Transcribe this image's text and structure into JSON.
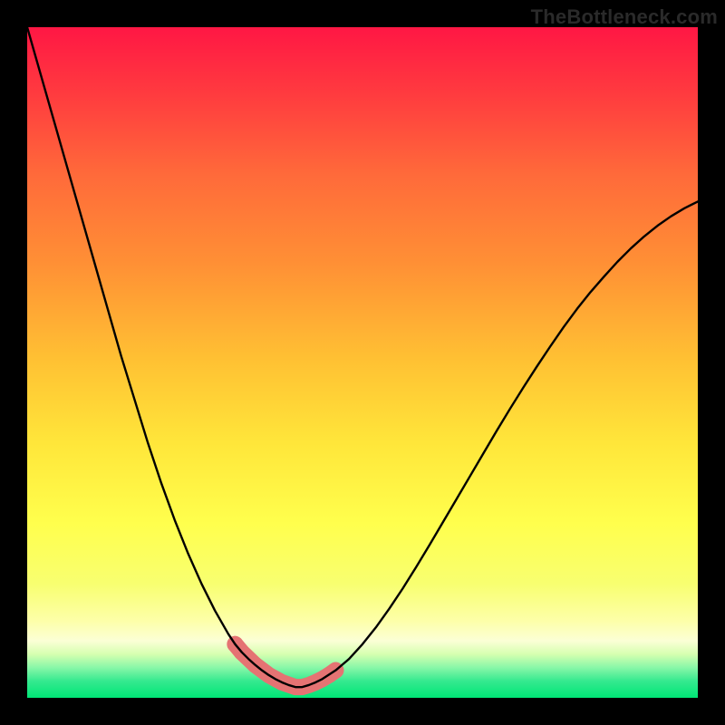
{
  "watermark": "TheBottleneck.com",
  "colors": {
    "frame": "#000000",
    "curve": "#000000",
    "marker": "#e57373",
    "gradient_stops": [
      {
        "offset": 0.0,
        "color": "#ff1744"
      },
      {
        "offset": 0.1,
        "color": "#ff3b3f"
      },
      {
        "offset": 0.22,
        "color": "#ff6a3a"
      },
      {
        "offset": 0.35,
        "color": "#ff8f35"
      },
      {
        "offset": 0.5,
        "color": "#ffc233"
      },
      {
        "offset": 0.62,
        "color": "#ffe63a"
      },
      {
        "offset": 0.74,
        "color": "#ffff4d"
      },
      {
        "offset": 0.83,
        "color": "#f8ff70"
      },
      {
        "offset": 0.885,
        "color": "#fdffa8"
      },
      {
        "offset": 0.915,
        "color": "#fbffd6"
      },
      {
        "offset": 0.935,
        "color": "#d6ffb0"
      },
      {
        "offset": 0.955,
        "color": "#88f7a8"
      },
      {
        "offset": 0.975,
        "color": "#35e98f"
      },
      {
        "offset": 1.0,
        "color": "#00e676"
      }
    ]
  },
  "chart_data": {
    "type": "line",
    "title": "",
    "xlabel": "",
    "ylabel": "",
    "xlim": [
      0,
      100
    ],
    "ylim": [
      0,
      100
    ],
    "grid": false,
    "legend": false,
    "x": [
      0,
      2,
      4,
      6,
      8,
      10,
      12,
      14,
      16,
      18,
      20,
      22,
      24,
      26,
      28,
      30,
      31,
      32,
      33,
      34,
      35,
      36,
      37,
      38,
      39,
      40,
      41,
      42,
      43,
      44,
      46,
      48,
      50,
      52,
      54,
      56,
      58,
      60,
      62,
      64,
      66,
      68,
      70,
      72,
      74,
      76,
      78,
      80,
      82,
      84,
      86,
      88,
      90,
      92,
      94,
      96,
      98,
      100
    ],
    "y": [
      100,
      93,
      86,
      79,
      72,
      65,
      58,
      51,
      44.5,
      38,
      32,
      26.5,
      21.5,
      17,
      13,
      9.5,
      8,
      6.8,
      5.8,
      4.9,
      4.1,
      3.4,
      2.8,
      2.3,
      1.9,
      1.6,
      1.6,
      1.9,
      2.3,
      2.8,
      4.1,
      5.8,
      8,
      10.5,
      13.3,
      16.3,
      19.5,
      22.8,
      26.2,
      29.6,
      33,
      36.4,
      39.8,
      43.1,
      46.3,
      49.4,
      52.4,
      55.3,
      58,
      60.5,
      62.8,
      65,
      67,
      68.8,
      70.4,
      71.8,
      73,
      74
    ],
    "markers_x": [
      31,
      32,
      34,
      36,
      38,
      40,
      41,
      42,
      43,
      44,
      45,
      46
    ],
    "markers_y": [
      8,
      6.8,
      4.9,
      3.4,
      2.3,
      1.6,
      1.6,
      1.9,
      2.3,
      2.8,
      3.4,
      4.1
    ]
  }
}
